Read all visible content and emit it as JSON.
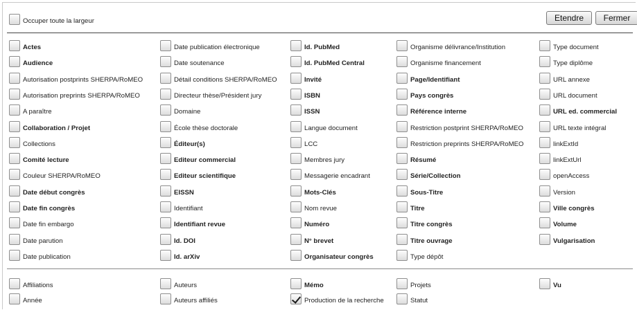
{
  "header": {
    "full_width_label": "Occuper toute la largeur",
    "full_width_checked": false,
    "expand_label": "Etendre",
    "close_label": "Fermer"
  },
  "columns": [
    [
      {
        "label": "Actes",
        "bold": true,
        "checked": false
      },
      {
        "label": "Audience",
        "bold": true,
        "checked": false
      },
      {
        "label": "Autorisation postprints SHERPA/RoMEO",
        "bold": false,
        "checked": false
      },
      {
        "label": "Autorisation preprints SHERPA/RoMEO",
        "bold": false,
        "checked": false
      },
      {
        "label": "A paraître",
        "bold": false,
        "checked": false
      },
      {
        "label": "Collaboration / Projet",
        "bold": true,
        "checked": false
      },
      {
        "label": "Collections",
        "bold": false,
        "checked": false
      },
      {
        "label": "Comité lecture",
        "bold": true,
        "checked": false
      },
      {
        "label": "Couleur SHERPA/RoMEO",
        "bold": false,
        "checked": false
      },
      {
        "label": "Date début congrès",
        "bold": true,
        "checked": false
      },
      {
        "label": "Date fin congrès",
        "bold": true,
        "checked": false
      },
      {
        "label": "Date fin embargo",
        "bold": false,
        "checked": false
      },
      {
        "label": "Date parution",
        "bold": false,
        "checked": false
      },
      {
        "label": "Date publication",
        "bold": false,
        "checked": false
      }
    ],
    [
      {
        "label": "Date publication électronique",
        "bold": false,
        "checked": false
      },
      {
        "label": "Date soutenance",
        "bold": false,
        "checked": false
      },
      {
        "label": "Détail conditions SHERPA/RoMEO",
        "bold": false,
        "checked": false
      },
      {
        "label": "Directeur thèse/Président jury",
        "bold": false,
        "checked": false
      },
      {
        "label": "Domaine",
        "bold": false,
        "checked": false
      },
      {
        "label": "École thèse doctorale",
        "bold": false,
        "checked": false
      },
      {
        "label": "Éditeur(s)",
        "bold": true,
        "checked": false
      },
      {
        "label": "Editeur commercial",
        "bold": true,
        "checked": false
      },
      {
        "label": "Editeur scientifique",
        "bold": true,
        "checked": false
      },
      {
        "label": "EISSN",
        "bold": true,
        "checked": false
      },
      {
        "label": "Identifiant",
        "bold": false,
        "checked": false
      },
      {
        "label": "Identifiant revue",
        "bold": true,
        "checked": false
      },
      {
        "label": "Id. DOI",
        "bold": true,
        "checked": false
      },
      {
        "label": "Id. arXiv",
        "bold": true,
        "checked": false
      }
    ],
    [
      {
        "label": "Id. PubMed",
        "bold": true,
        "checked": false
      },
      {
        "label": "Id. PubMed Central",
        "bold": true,
        "checked": false
      },
      {
        "label": "Invité",
        "bold": true,
        "checked": false
      },
      {
        "label": "ISBN",
        "bold": true,
        "checked": false
      },
      {
        "label": "ISSN",
        "bold": true,
        "checked": false
      },
      {
        "label": "Langue document",
        "bold": false,
        "checked": false
      },
      {
        "label": "LCC",
        "bold": false,
        "checked": false
      },
      {
        "label": "Membres jury",
        "bold": false,
        "checked": false
      },
      {
        "label": "Messagerie encadrant",
        "bold": false,
        "checked": false
      },
      {
        "label": "Mots-Clés",
        "bold": true,
        "checked": false
      },
      {
        "label": "Nom revue",
        "bold": false,
        "checked": false
      },
      {
        "label": "Numéro",
        "bold": true,
        "checked": false
      },
      {
        "label": "N° brevet",
        "bold": true,
        "checked": false
      },
      {
        "label": "Organisateur congrès",
        "bold": true,
        "checked": false
      }
    ],
    [
      {
        "label": "Organisme délivrance/Institution",
        "bold": false,
        "checked": false
      },
      {
        "label": "Organisme financement",
        "bold": false,
        "checked": false
      },
      {
        "label": "Page/Identifiant",
        "bold": true,
        "checked": false
      },
      {
        "label": "Pays congrès",
        "bold": true,
        "checked": false
      },
      {
        "label": "Référence interne",
        "bold": true,
        "checked": false
      },
      {
        "label": "Restriction postprint SHERPA/RoMEO",
        "bold": false,
        "checked": false
      },
      {
        "label": "Restriction preprints SHERPA/RoMEO",
        "bold": false,
        "checked": false
      },
      {
        "label": "Résumé",
        "bold": true,
        "checked": false
      },
      {
        "label": "Série/Collection",
        "bold": true,
        "checked": false
      },
      {
        "label": "Sous-Titre",
        "bold": true,
        "checked": false
      },
      {
        "label": "Titre",
        "bold": true,
        "checked": false
      },
      {
        "label": "Titre congrès",
        "bold": true,
        "checked": false
      },
      {
        "label": "Titre ouvrage",
        "bold": true,
        "checked": false
      },
      {
        "label": "Type dépôt",
        "bold": false,
        "checked": false
      }
    ],
    [
      {
        "label": "Type document",
        "bold": false,
        "checked": false
      },
      {
        "label": "Type diplôme",
        "bold": false,
        "checked": false
      },
      {
        "label": "URL annexe",
        "bold": false,
        "checked": false
      },
      {
        "label": "URL document",
        "bold": false,
        "checked": false
      },
      {
        "label": "URL ed. commercial",
        "bold": true,
        "checked": false
      },
      {
        "label": "URL texte intégral",
        "bold": false,
        "checked": false
      },
      {
        "label": "linkExtId",
        "bold": false,
        "checked": false
      },
      {
        "label": "linkExtUrl",
        "bold": false,
        "checked": false
      },
      {
        "label": "openAccess",
        "bold": false,
        "checked": false
      },
      {
        "label": "Version",
        "bold": false,
        "checked": false
      },
      {
        "label": "Ville congrès",
        "bold": true,
        "checked": false
      },
      {
        "label": "Volume",
        "bold": true,
        "checked": false
      },
      {
        "label": "Vulgarisation",
        "bold": true,
        "checked": false
      }
    ]
  ],
  "facets": [
    [
      {
        "label": "Affiliations",
        "bold": false,
        "checked": false
      },
      {
        "label": "Année",
        "bold": false,
        "checked": false
      }
    ],
    [
      {
        "label": "Auteurs",
        "bold": false,
        "checked": false
      },
      {
        "label": "Auteurs affiliés",
        "bold": false,
        "checked": false
      }
    ],
    [
      {
        "label": "Mémo",
        "bold": true,
        "checked": false
      },
      {
        "label": "Production de la recherche",
        "bold": false,
        "checked": true
      }
    ],
    [
      {
        "label": "Projets",
        "bold": false,
        "checked": false
      },
      {
        "label": "Statut",
        "bold": false,
        "checked": false
      }
    ],
    [
      {
        "label": "Vu",
        "bold": true,
        "checked": false
      }
    ]
  ]
}
